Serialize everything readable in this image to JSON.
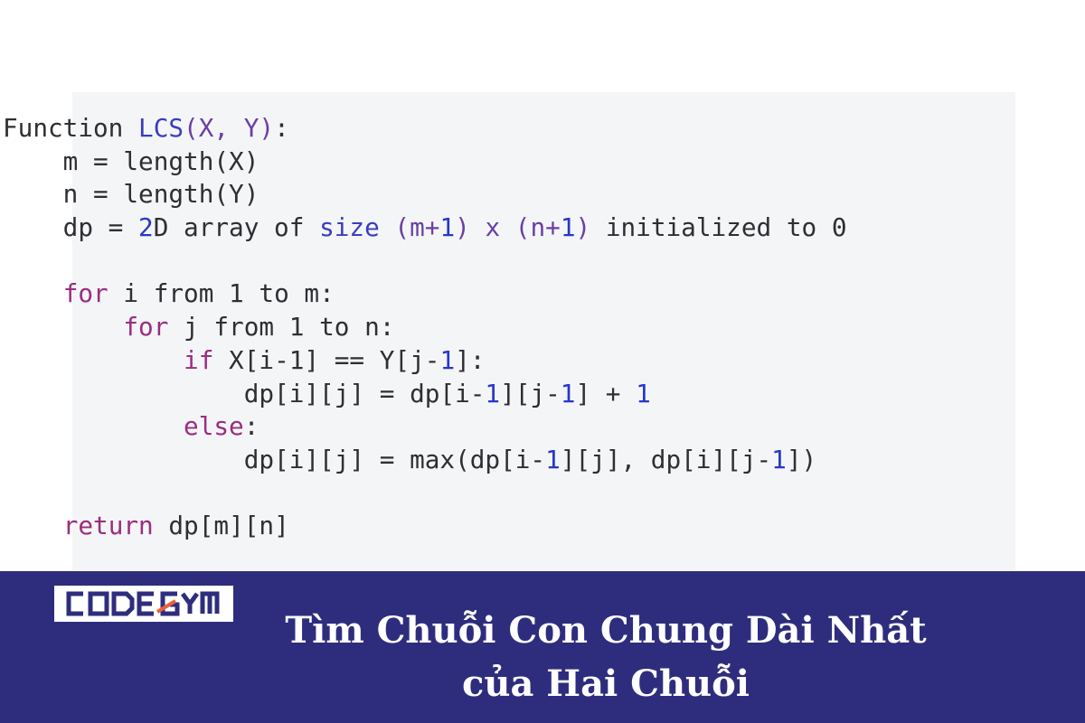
{
  "colors": {
    "code_background": "#f4f5f7",
    "banner_background": "#2e2d7d",
    "keyword": "#9a2d7f",
    "function_name": "#3b3dbf",
    "parameter": "#6a3fa3",
    "number": "#2637c9",
    "text": "#2f2f33",
    "logo_accent": "#e8623a"
  },
  "logo": {
    "brand": "CODEGYM"
  },
  "title": {
    "line1": "Tìm Chuỗi Con Chung Dài Nhất",
    "line2": "của Hai Chuỗi"
  },
  "code": {
    "lines": [
      [
        {
          "t": "Function ",
          "c": ""
        },
        {
          "t": "LCS",
          "c": "f"
        },
        {
          "t": "(X, Y)",
          "c": "p"
        },
        {
          "t": ":",
          "c": ""
        }
      ],
      [
        {
          "t": "    m = length(X)",
          "c": ""
        }
      ],
      [
        {
          "t": "    n = length(Y)",
          "c": ""
        }
      ],
      [
        {
          "t": "    dp = ",
          "c": ""
        },
        {
          "t": "2",
          "c": "n"
        },
        {
          "t": "D array of ",
          "c": ""
        },
        {
          "t": "size",
          "c": "f"
        },
        {
          "t": " (m+",
          "c": "p"
        },
        {
          "t": "1",
          "c": "n"
        },
        {
          "t": ") x (n+",
          "c": "p"
        },
        {
          "t": "1",
          "c": "n"
        },
        {
          "t": ")",
          "c": "p"
        },
        {
          "t": " initialized to 0",
          "c": ""
        }
      ],
      [],
      [
        {
          "t": "    ",
          "c": ""
        },
        {
          "t": "for",
          "c": "k"
        },
        {
          "t": " i from 1 to m:",
          "c": ""
        }
      ],
      [
        {
          "t": "        ",
          "c": ""
        },
        {
          "t": "for",
          "c": "k"
        },
        {
          "t": " j from 1 to n:",
          "c": ""
        }
      ],
      [
        {
          "t": "            ",
          "c": ""
        },
        {
          "t": "if",
          "c": "k"
        },
        {
          "t": " X[i-1] == Y[j-",
          "c": ""
        },
        {
          "t": "1",
          "c": "n"
        },
        {
          "t": "]:",
          "c": ""
        }
      ],
      [
        {
          "t": "                dp[i][j] = dp[i-",
          "c": ""
        },
        {
          "t": "1",
          "c": "n"
        },
        {
          "t": "][j-",
          "c": ""
        },
        {
          "t": "1",
          "c": "n"
        },
        {
          "t": "] + ",
          "c": ""
        },
        {
          "t": "1",
          "c": "n"
        }
      ],
      [
        {
          "t": "            ",
          "c": ""
        },
        {
          "t": "else",
          "c": "k"
        },
        {
          "t": ":",
          "c": ""
        }
      ],
      [
        {
          "t": "                dp[i][j] = max(dp[i-",
          "c": ""
        },
        {
          "t": "1",
          "c": "n"
        },
        {
          "t": "][j], dp[i][j-",
          "c": ""
        },
        {
          "t": "1",
          "c": "n"
        },
        {
          "t": "])",
          "c": ""
        }
      ],
      [],
      [
        {
          "t": "    ",
          "c": ""
        },
        {
          "t": "return",
          "c": "k"
        },
        {
          "t": " dp[m][n]",
          "c": ""
        }
      ]
    ]
  }
}
